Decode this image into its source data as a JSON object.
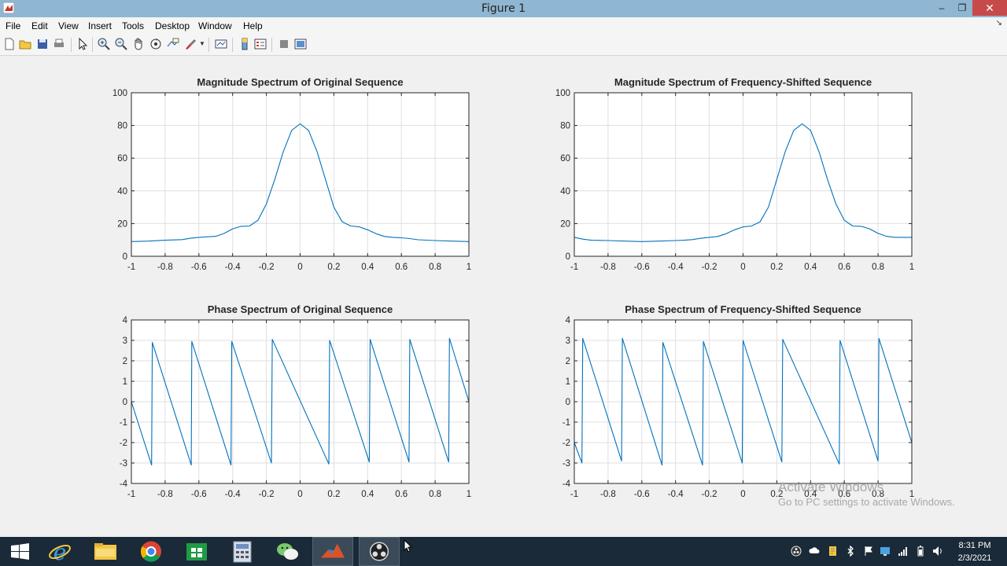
{
  "window": {
    "title": "Figure 1",
    "minimize": "–",
    "restore": "❐",
    "close": "✕"
  },
  "menu": [
    "File",
    "Edit",
    "View",
    "Insert",
    "Tools",
    "Desktop",
    "Window",
    "Help"
  ],
  "toolbar": {
    "icons": [
      "new-figure-icon",
      "open-file-icon",
      "save-icon",
      "print-icon",
      "pointer-icon",
      "zoom-in-icon",
      "zoom-out-icon",
      "pan-icon",
      "rotate-3d-icon",
      "data-cursor-icon",
      "brush-icon",
      "link-plot-icon",
      "colorbar-icon",
      "legend-icon",
      "hide-plot-tools-icon",
      "show-plot-tools-icon"
    ]
  },
  "colors": {
    "line": "#0072bd",
    "grid": "#dfdfdf",
    "axes_bg": "#ffffff",
    "fig_bg": "#f0f0f0",
    "titlebar": "#8fb6d2",
    "taskbar": "#1b2a38"
  },
  "chart_data": [
    {
      "type": "line",
      "title": "Magnitude Spectrum of Original Sequence",
      "xlabel": "",
      "ylabel": "",
      "xlim": [
        -1,
        1
      ],
      "ylim": [
        0,
        100
      ],
      "xticks": [
        -1,
        -0.8,
        -0.6,
        -0.4,
        -0.2,
        0,
        0.2,
        0.4,
        0.6,
        0.8,
        1
      ],
      "yticks": [
        0,
        20,
        40,
        60,
        80,
        100
      ],
      "xtick_labels": [
        "-1",
        "-0.8",
        "-0.6",
        "-0.4",
        "-0.2",
        "0",
        "0.2",
        "0.4",
        "0.6",
        "0.8",
        "1"
      ],
      "ytick_labels": [
        "0",
        "20",
        "40",
        "60",
        "80",
        "100"
      ],
      "grid": true,
      "x": [
        -1,
        -0.9,
        -0.8,
        -0.7,
        -0.65,
        -0.6,
        -0.5,
        -0.45,
        -0.4,
        -0.35,
        -0.3,
        -0.25,
        -0.2,
        -0.15,
        -0.1,
        -0.05,
        0,
        0.05,
        0.1,
        0.15,
        0.2,
        0.25,
        0.3,
        0.35,
        0.4,
        0.45,
        0.5,
        0.55,
        0.6,
        0.65,
        0.7,
        0.8,
        0.9,
        1
      ],
      "y": [
        9,
        9.3,
        9.8,
        10.2,
        11,
        11.6,
        12.2,
        14,
        16.8,
        18.3,
        18.5,
        22,
        32,
        47,
        64,
        77,
        81,
        77,
        64,
        47,
        30,
        21,
        18.5,
        18,
        16.2,
        13.8,
        12.1,
        11.6,
        11.3,
        10.8,
        10.1,
        9.6,
        9.3,
        9
      ]
    },
    {
      "type": "line",
      "title": "Magnitude Spectrum of Frequency-Shifted Sequence",
      "xlabel": "",
      "ylabel": "",
      "xlim": [
        -1,
        1
      ],
      "ylim": [
        0,
        100
      ],
      "xticks": [
        -1,
        -0.8,
        -0.6,
        -0.4,
        -0.2,
        0,
        0.2,
        0.4,
        0.6,
        0.8,
        1
      ],
      "yticks": [
        0,
        20,
        40,
        60,
        80,
        100
      ],
      "xtick_labels": [
        "-1",
        "-0.8",
        "-0.6",
        "-0.4",
        "-0.2",
        "0",
        "0.2",
        "0.4",
        "0.6",
        "0.8",
        "1"
      ],
      "ytick_labels": [
        "0",
        "20",
        "40",
        "60",
        "80",
        "100"
      ],
      "grid": true,
      "x": [
        -1,
        -0.95,
        -0.9,
        -0.8,
        -0.7,
        -0.6,
        -0.5,
        -0.4,
        -0.35,
        -0.3,
        -0.25,
        -0.2,
        -0.15,
        -0.1,
        -0.05,
        0,
        0.05,
        0.1,
        0.15,
        0.2,
        0.25,
        0.3,
        0.35,
        0.4,
        0.45,
        0.5,
        0.55,
        0.6,
        0.65,
        0.7,
        0.75,
        0.8,
        0.85,
        0.9,
        0.95,
        1
      ],
      "y": [
        11.6,
        10.5,
        9.8,
        9.6,
        9.3,
        9,
        9.3,
        9.6,
        9.8,
        10.2,
        11,
        11.6,
        12.1,
        13.8,
        16.2,
        18,
        18.5,
        21,
        30,
        47,
        64,
        77,
        81,
        77,
        64,
        47,
        32,
        22,
        18.5,
        18.3,
        16.8,
        14,
        12.2,
        11.6,
        11.6,
        11.6
      ]
    },
    {
      "type": "line",
      "title": "Phase Spectrum of Original Sequence",
      "xlabel": "",
      "ylabel": "",
      "xlim": [
        -1,
        1
      ],
      "ylim": [
        -4,
        4
      ],
      "xticks": [
        -1,
        -0.8,
        -0.6,
        -0.4,
        -0.2,
        0,
        0.2,
        0.4,
        0.6,
        0.8,
        1
      ],
      "yticks": [
        -4,
        -3,
        -2,
        -1,
        0,
        1,
        2,
        3,
        4
      ],
      "xtick_labels": [
        "-1",
        "-0.8",
        "-0.6",
        "-0.4",
        "-0.2",
        "0",
        "0.2",
        "0.4",
        "0.6",
        "0.8",
        "1"
      ],
      "ytick_labels": [
        "-4",
        "-3",
        "-2",
        "-1",
        "0",
        "1",
        "2",
        "3",
        "4"
      ],
      "grid": true,
      "x": [
        -1,
        -0.88,
        -0.876,
        -0.645,
        -0.642,
        -0.41,
        -0.405,
        -0.17,
        -0.165,
        0.17,
        0.175,
        0.41,
        0.415,
        0.645,
        0.65,
        0.88,
        0.885,
        1
      ],
      "y": [
        0,
        -3.1,
        2.9,
        -3.1,
        2.95,
        -3.1,
        2.95,
        -3.0,
        3.05,
        -3.05,
        3.0,
        -2.95,
        3.05,
        -2.95,
        3.05,
        -2.95,
        3.1,
        0
      ]
    },
    {
      "type": "line",
      "title": "Phase Spectrum of Frequency-Shifted Sequence",
      "xlabel": "",
      "ylabel": "",
      "xlim": [
        -1,
        1
      ],
      "ylim": [
        -4,
        4
      ],
      "xticks": [
        -1,
        -0.8,
        -0.6,
        -0.4,
        -0.2,
        0,
        0.2,
        0.4,
        0.6,
        0.8,
        1
      ],
      "yticks": [
        -4,
        -3,
        -2,
        -1,
        0,
        1,
        2,
        3,
        4
      ],
      "xtick_labels": [
        "-1",
        "-0.8",
        "-0.6",
        "-0.4",
        "-0.2",
        "0",
        "0.2",
        "0.4",
        "0.6",
        "0.8",
        "1"
      ],
      "ytick_labels": [
        "-4",
        "-3",
        "-2",
        "-1",
        "0",
        "1",
        "2",
        "3",
        "4"
      ],
      "grid": true,
      "x": [
        -1,
        -0.955,
        -0.95,
        -0.72,
        -0.715,
        -0.48,
        -0.475,
        -0.24,
        -0.235,
        -0.005,
        0.0,
        0.23,
        0.235,
        0.57,
        0.575,
        0.8,
        0.805,
        1
      ],
      "y": [
        -2,
        -3.0,
        3.1,
        -2.9,
        3.1,
        -3.1,
        2.9,
        -3.1,
        2.95,
        -3.0,
        3.0,
        -2.95,
        3.05,
        -3.05,
        3.0,
        -2.9,
        3.1,
        -2.0
      ]
    }
  ],
  "watermark": {
    "line1": "Activate Windows",
    "line2": "Go to PC settings to activate Windows."
  },
  "taskbar": {
    "apps": [
      "windows-start-icon",
      "internet-explorer-icon",
      "file-explorer-icon",
      "chrome-icon",
      "windows-store-icon",
      "calculator-icon",
      "wechat-icon",
      "matlab-icon",
      "obs-icon"
    ],
    "tray": [
      "obs-tray-icon",
      "cloud-icon",
      "notes-icon",
      "bluetooth-icon",
      "flag-icon",
      "network-icon",
      "signal-icon",
      "battery-icon",
      "volume-icon"
    ]
  },
  "clock": {
    "time": "8:31 PM",
    "date": "2/3/2021"
  }
}
